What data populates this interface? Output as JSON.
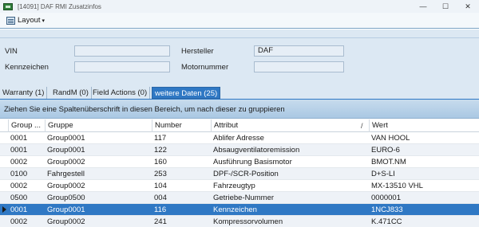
{
  "window": {
    "title": "[14091]  DAF RMI Zusatzinfos",
    "minimize": "—",
    "maximize": "☐",
    "close": "✕"
  },
  "toolbar": {
    "layout_label": "Layout",
    "caret": "▾"
  },
  "form": {
    "vin_label": "VIN",
    "vin_value": "",
    "kennzeichen_label": "Kennzeichen",
    "kennzeichen_value": "",
    "hersteller_label": "Hersteller",
    "hersteller_value": "DAF",
    "motornummer_label": "Motornummer",
    "motornummer_value": ""
  },
  "tabs": [
    {
      "label": "Warranty (1)"
    },
    {
      "label": "RandM (0)"
    },
    {
      "label": "Field Actions (0)"
    },
    {
      "label": "weitere Daten (25)",
      "active": true
    }
  ],
  "grid": {
    "group_hint": "Ziehen Sie eine Spaltenüberschrift in diesen Bereich, um nach dieser zu gruppieren",
    "sort_mark": "/",
    "columns": [
      "Group ...",
      "Gruppe",
      "Number",
      "Attribut",
      "Wert"
    ],
    "rows": [
      {
        "group": "0001",
        "gruppe": "Group0001",
        "number": "117",
        "attribut": "Ablifer Adresse",
        "wert": "VAN HOOL"
      },
      {
        "group": "0001",
        "gruppe": "Group0001",
        "number": "122",
        "attribut": "Absaugventilatoremission",
        "wert": "EURO-6"
      },
      {
        "group": "0002",
        "gruppe": "Group0002",
        "number": "160",
        "attribut": "Ausführung Basismotor",
        "wert": "BMOT.NM"
      },
      {
        "group": "0100",
        "gruppe": "Fahrgestell",
        "number": "253",
        "attribut": "DPF-/SCR-Position",
        "wert": "D+S-LI"
      },
      {
        "group": "0002",
        "gruppe": "Group0002",
        "number": "104",
        "attribut": "Fahrzeugtyp",
        "wert": "MX-13510     VHL"
      },
      {
        "group": "0500",
        "gruppe": "Group0500",
        "number": "004",
        "attribut": "Getriebe-Nummer",
        "wert": "0000001"
      },
      {
        "group": "0001",
        "gruppe": "Group0001",
        "number": "116",
        "attribut": "Kennzeichen",
        "wert": "1NCJ833",
        "selected": true
      },
      {
        "group": "0002",
        "gruppe": "Group0002",
        "number": "241",
        "attribut": "Kompressorvolumen",
        "wert": "K.471CC"
      }
    ]
  },
  "colors": {
    "accent": "#2f78c4",
    "form_bg": "#dce8f3",
    "row_alt": "#eef2f7"
  }
}
